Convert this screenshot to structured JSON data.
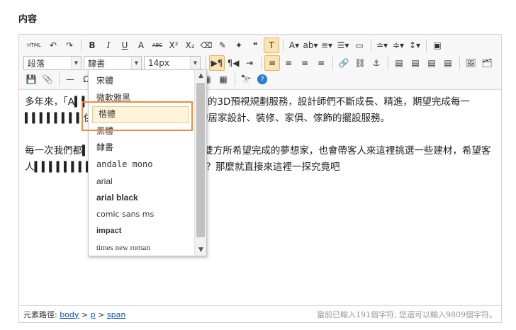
{
  "section_label": "内容",
  "toolbar": {
    "row1": [
      {
        "name": "html-source-button",
        "glyph": "HTML",
        "wide": true
      },
      {
        "name": "undo-button",
        "glyph": "↶"
      },
      {
        "name": "redo-button",
        "glyph": "↷"
      },
      {
        "sep": true
      },
      {
        "name": "bold-button",
        "glyph": "B"
      },
      {
        "name": "italic-button",
        "glyph": "I"
      },
      {
        "name": "underline-button",
        "glyph": "U"
      },
      {
        "name": "font-border-button",
        "glyph": "A"
      },
      {
        "name": "strikethrough-button",
        "glyph": "ABC"
      },
      {
        "name": "superscript-button",
        "glyph": "X²"
      },
      {
        "name": "subscript-button",
        "glyph": "X₂"
      },
      {
        "name": "eraser-button",
        "glyph": "⌫"
      },
      {
        "name": "format-brush-button",
        "glyph": "✎"
      },
      {
        "name": "auto-format-button",
        "glyph": "✦"
      },
      {
        "name": "blockquote-button",
        "glyph": "❝"
      },
      {
        "name": "paste-plain-button",
        "glyph": "T",
        "active": true
      },
      {
        "sep": true
      },
      {
        "name": "font-color-button",
        "glyph": "A▾"
      },
      {
        "name": "highlight-color-button",
        "glyph": "ab▾"
      },
      {
        "name": "ordered-list-button",
        "glyph": "≡▾"
      },
      {
        "name": "unordered-list-button",
        "glyph": "☰▾"
      },
      {
        "name": "select-all-button",
        "glyph": "▭"
      },
      {
        "sep": true
      },
      {
        "name": "row-spacing-top-button",
        "glyph": "≐▾"
      },
      {
        "name": "row-spacing-bottom-button",
        "glyph": "≑▾"
      },
      {
        "name": "line-height-button",
        "glyph": "↕▾"
      },
      {
        "sep": true
      },
      {
        "name": "fullscreen-button",
        "glyph": "▣"
      }
    ],
    "paragraph_value": "段落",
    "font_value": "隸書",
    "size_value": "14px",
    "row2": [
      {
        "name": "ltr-direction-button",
        "glyph": "▶¶",
        "active": true
      },
      {
        "name": "rtl-direction-button",
        "glyph": "¶◀"
      },
      {
        "name": "indent-button",
        "glyph": "⇥"
      },
      {
        "sep": true
      },
      {
        "name": "align-left-button",
        "glyph": "≡",
        "active": true
      },
      {
        "name": "align-center-button",
        "glyph": "≡"
      },
      {
        "name": "align-right-button",
        "glyph": "≡"
      },
      {
        "name": "align-justify-button",
        "glyph": "≡"
      },
      {
        "sep": true
      },
      {
        "name": "link-button",
        "glyph": "🔗"
      },
      {
        "name": "unlink-button",
        "glyph": "⛓"
      },
      {
        "name": "anchor-button",
        "glyph": "⚓"
      },
      {
        "sep": true
      },
      {
        "name": "image-none-button",
        "glyph": "▤"
      },
      {
        "name": "image-left-button",
        "glyph": "▤"
      },
      {
        "name": "image-right-button",
        "glyph": "▤"
      },
      {
        "name": "image-center-button",
        "glyph": "▤"
      },
      {
        "sep": true
      },
      {
        "name": "insert-image-button",
        "glyph": "🖼"
      },
      {
        "name": "insert-multi-image-button",
        "glyph": "🗂"
      }
    ],
    "row3": [
      {
        "name": "save-icon-button",
        "glyph": "💾"
      },
      {
        "name": "attachment-button",
        "glyph": "📎"
      },
      {
        "sep": true
      },
      {
        "name": "horizontal-rule-button",
        "glyph": "—"
      },
      {
        "name": "special-char-button",
        "glyph": "Ω"
      },
      {
        "sep": true
      },
      {
        "name": "table-insert-button",
        "glyph": "▦"
      },
      {
        "name": "table-delete-button",
        "glyph": "▦"
      },
      {
        "name": "table-row-before-button",
        "glyph": "▦"
      },
      {
        "name": "table-row-after-button",
        "glyph": "▦"
      },
      {
        "name": "table-col-before-button",
        "glyph": "▦"
      },
      {
        "name": "table-col-after-button",
        "glyph": "▦"
      },
      {
        "name": "table-merge-button",
        "glyph": "▦"
      },
      {
        "name": "table-split-button",
        "glyph": "▦"
      },
      {
        "sep": true
      },
      {
        "name": "search-replace-button",
        "glyph": "🔭"
      },
      {
        "name": "help-button",
        "glyph": "?"
      }
    ]
  },
  "content": {
    "paragraphs": [
      "多年來，「A▍▍▍▍▍▍▍▍▍」直到現代科技的3D預視規劃服務，設計師們不斷成長、精進，期望完成每一▍▍▍▍▍▍▍▍供專業的裝潢建議、全方位的居家設計、裝修、家俱、傢飾的擺設服務。",
      "每一次我們都▍▍▍▍▍▍▍▍▍▍間裡，談論雙方所希望完成的夢想家，也會帶客人來這裡挑選一些建材，希望客人▍▍▍▍▍▍▍▍▍，害怕設計品質無法掌握？那麼就直接來這裡一探究竟吧"
    ]
  },
  "font_dropdown": {
    "options": [
      "宋體",
      "微軟雅黑",
      "楷體",
      "黑體",
      "隸書",
      "andale mono",
      "arial",
      "arial black",
      "comic sans ms",
      "impact",
      "times new roman"
    ],
    "highlighted": "楷體"
  },
  "status": {
    "path_label": "元素路徑:",
    "path_body": "body",
    "path_gt1": ">",
    "path_p": "p",
    "path_gt2": ">",
    "path_span": "span",
    "count_text": "當前已輸入191個字符, 您還可以輸入9809個字符。"
  },
  "colors": {
    "active_bg": "#fbe3b4",
    "callout_border": "#f08a3c",
    "link_blue": "#0050b3"
  }
}
